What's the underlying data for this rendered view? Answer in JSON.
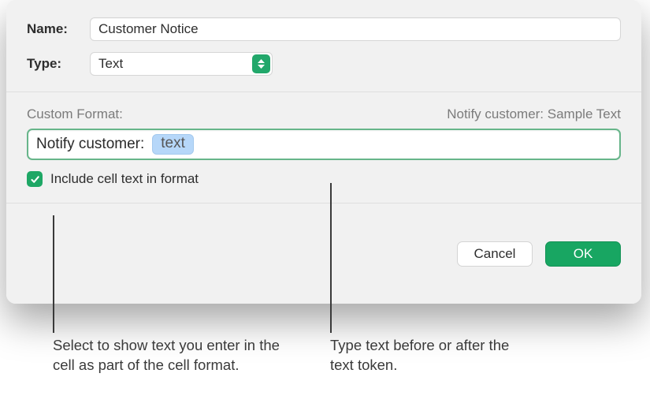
{
  "labels": {
    "name": "Name:",
    "type": "Type:",
    "custom_format": "Custom Format:"
  },
  "name_value": "Customer Notice",
  "type_value": "Text",
  "preview": "Notify customer: Sample Text",
  "format_prefix": "Notify customer:",
  "token_label": "text",
  "include_label": "Include cell text in format",
  "buttons": {
    "cancel": "Cancel",
    "ok": "OK"
  },
  "callouts": {
    "left": "Select to show text you enter in the cell as part of the cell format.",
    "right": "Type text before or after the text token."
  },
  "colors": {
    "accent": "#18a662"
  }
}
